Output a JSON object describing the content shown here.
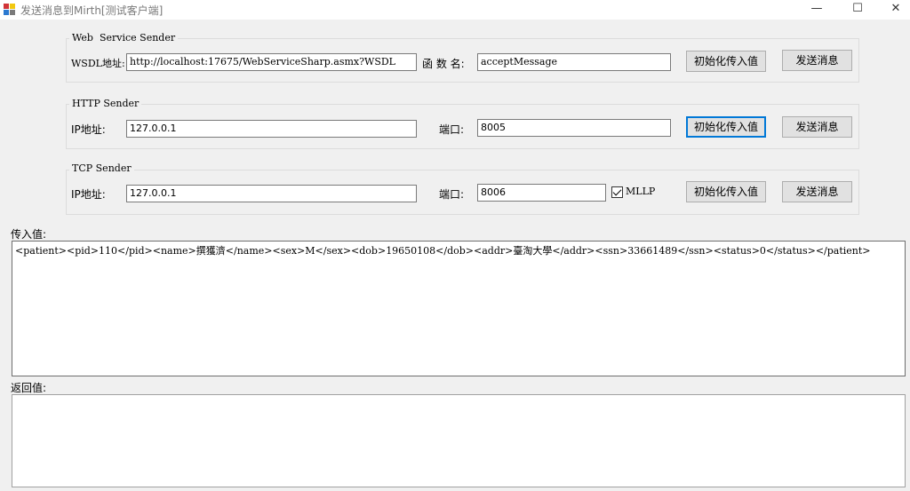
{
  "window": {
    "title": "发送消息到Mirth[测试客户端]",
    "minimize": "—",
    "maximize": "☐",
    "close": "✕"
  },
  "web_service": {
    "group_title": "Web  Service Sender",
    "wsdl_label": "WSDL地址:",
    "wsdl_value": "http://localhost:17675/WebServiceSharp.asmx?WSDL",
    "function_label": "函 数 名:",
    "function_value": "acceptMessage",
    "init_button": "初始化传入值",
    "send_button": "发送消息"
  },
  "http": {
    "group_title": "HTTP Sender",
    "ip_label": "IP地址:",
    "ip_value": "127.0.0.1",
    "port_label": "端口:",
    "port_value": "8005",
    "init_button": "初始化传入值",
    "send_button": "发送消息"
  },
  "tcp": {
    "group_title": "TCP Sender",
    "ip_label": "IP地址:",
    "ip_value": "127.0.0.1",
    "port_label": "端口:",
    "port_value": "8006",
    "mllp_label": "MLLP",
    "mllp_checked": true,
    "init_button": "初始化传入值",
    "send_button": "发送消息"
  },
  "input": {
    "label": "传入值:",
    "value": "<patient><pid>110</pid><name>撰獲濟</name><sex>M</sex><dob>19650108</dob><addr>臺淘大學</addr><ssn>33661489</ssn><status>0</status></patient>"
  },
  "output": {
    "label": "返回值:",
    "value": ""
  },
  "colors": {
    "window_bg": "#f0f0f0",
    "focus_border": "#0078d7",
    "button_bg": "#e1e1e1"
  }
}
